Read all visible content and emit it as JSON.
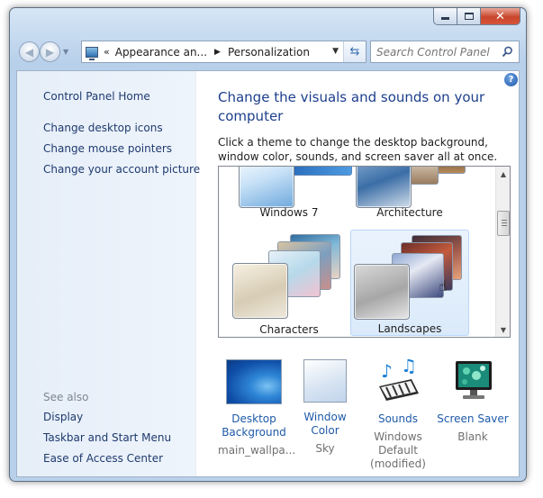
{
  "window": {
    "caption_buttons": {
      "minimize_icon": "minimize-icon",
      "maximize_icon": "maximize-icon",
      "close_icon": "close-icon"
    }
  },
  "nav": {
    "back_icon": "back-arrow-icon",
    "forward_icon": "forward-arrow-icon",
    "breadcrumb_prefix": "«",
    "breadcrumb": [
      "Appearance an...",
      "Personalization"
    ],
    "refresh_icon": "refresh-icon",
    "search_placeholder": "Search Control Panel",
    "search_icon": "magnifier-icon"
  },
  "sidebar": {
    "home": "Control Panel Home",
    "links": [
      "Change desktop icons",
      "Change mouse pointers",
      "Change your account picture"
    ],
    "see_also_heading": "See also",
    "see_also": [
      "Display",
      "Taskbar and Start Menu",
      "Ease of Access Center"
    ]
  },
  "main": {
    "title": "Change the visuals and sounds on your computer",
    "description": "Click a theme to change the desktop background, window color, sounds, and screen saver all at once.",
    "themes": [
      {
        "label": "Windows 7",
        "selected": false
      },
      {
        "label": "Architecture",
        "selected": false
      },
      {
        "label": "Characters",
        "selected": false
      },
      {
        "label": "Landscapes",
        "selected": true
      }
    ],
    "settings": [
      {
        "title": "Desktop Background",
        "subtitle": "main_wallpa...",
        "icon": "desktop-background-icon"
      },
      {
        "title": "Window Color",
        "subtitle": "Sky",
        "icon": "window-color-icon"
      },
      {
        "title": "Sounds",
        "subtitle": "Windows Default (modified)",
        "icon": "sounds-icon"
      },
      {
        "title": "Screen Saver",
        "subtitle": "Blank",
        "icon": "screen-saver-icon"
      }
    ]
  },
  "colors": {
    "link": "#1e3a6e",
    "title": "#1d3f8c",
    "setting_link": "#1e5aa8",
    "selection": "#dbeafa"
  }
}
